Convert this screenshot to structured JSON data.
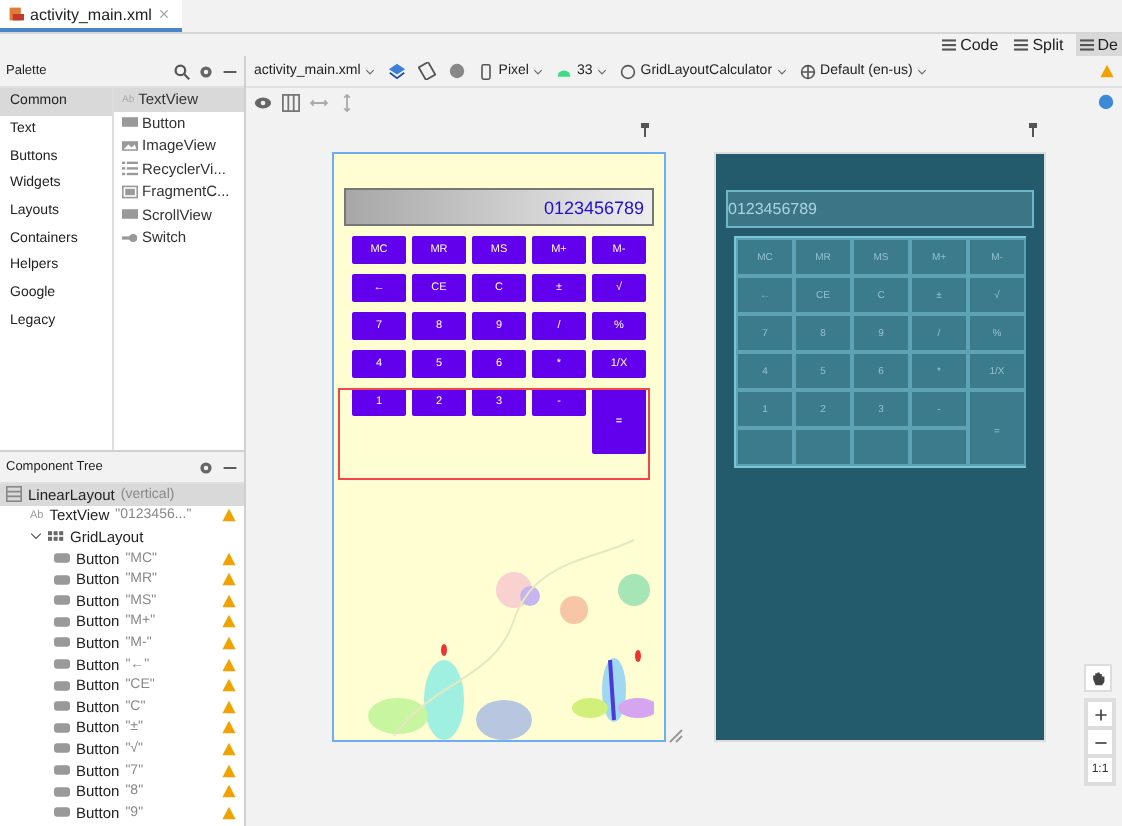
{
  "editor_tabs": [
    {
      "label": "activity_main.xml",
      "selected": true
    }
  ],
  "view_modes": [
    {
      "label": "Code",
      "selected": false
    },
    {
      "label": "Split",
      "selected": false
    },
    {
      "label": "De",
      "selected": true
    }
  ],
  "palette": {
    "title": "Palette",
    "categories": [
      {
        "label": "Common",
        "selected": true
      },
      {
        "label": "Text",
        "selected": false
      },
      {
        "label": "Buttons",
        "selected": false
      },
      {
        "label": "Widgets",
        "selected": false
      },
      {
        "label": "Layouts",
        "selected": false
      },
      {
        "label": "Containers",
        "selected": false
      },
      {
        "label": "Helpers",
        "selected": false
      },
      {
        "label": "Google",
        "selected": false
      },
      {
        "label": "Legacy",
        "selected": false
      }
    ],
    "items": [
      {
        "label": "TextView",
        "kind": "text",
        "badge": "Ab",
        "selected": true
      },
      {
        "label": "Button",
        "kind": "button",
        "selected": false
      },
      {
        "label": "ImageView",
        "kind": "image",
        "selected": false
      },
      {
        "label": "RecyclerVi...",
        "kind": "list",
        "selected": false
      },
      {
        "label": "FragmentC...",
        "kind": "fragment",
        "selected": false
      },
      {
        "label": "ScrollView",
        "kind": "button",
        "selected": false
      },
      {
        "label": "Switch",
        "kind": "switch",
        "selected": false
      }
    ]
  },
  "toolbar": {
    "file": "activity_main.xml",
    "device": "Pixel",
    "api": "33",
    "theme": "GridLayoutCalculator",
    "locale": "Default (en-us)"
  },
  "component_tree": {
    "title": "Component Tree",
    "nodes": [
      {
        "kind": "linear",
        "type": "LinearLayout",
        "detail": "(vertical)",
        "selected": true,
        "warning": false,
        "children": [
          {
            "kind": "text",
            "badge": "Ab",
            "type": "TextView",
            "detail": "\"0123456...\"",
            "selected": false,
            "warning": true
          },
          {
            "kind": "grid",
            "type": "GridLayout",
            "selected": false,
            "warning": false,
            "expanded": true,
            "children": [
              {
                "kind": "button",
                "type": "Button",
                "detail": "\"MC\"",
                "selected": false,
                "warning": true
              },
              {
                "kind": "button",
                "type": "Button",
                "detail": "\"MR\"",
                "selected": false,
                "warning": true
              },
              {
                "kind": "button",
                "type": "Button",
                "detail": "\"MS\"",
                "selected": false,
                "warning": true
              },
              {
                "kind": "button",
                "type": "Button",
                "detail": "\"M+\"",
                "selected": false,
                "warning": true
              },
              {
                "kind": "button",
                "type": "Button",
                "detail": "\"M-\"",
                "selected": false,
                "warning": true
              },
              {
                "kind": "button",
                "type": "Button",
                "detail": "\"←\"",
                "selected": false,
                "warning": true
              },
              {
                "kind": "button",
                "type": "Button",
                "detail": "\"CE\"",
                "selected": false,
                "warning": true
              },
              {
                "kind": "button",
                "type": "Button",
                "detail": "\"C\"",
                "selected": false,
                "warning": true
              },
              {
                "kind": "button",
                "type": "Button",
                "detail": "\"±\"",
                "selected": false,
                "warning": true
              },
              {
                "kind": "button",
                "type": "Button",
                "detail": "\"√\"",
                "selected": false,
                "warning": true
              },
              {
                "kind": "button",
                "type": "Button",
                "detail": "\"7\"",
                "selected": false,
                "warning": true
              },
              {
                "kind": "button",
                "type": "Button",
                "detail": "\"8\"",
                "selected": false,
                "warning": true
              },
              {
                "kind": "button",
                "type": "Button",
                "detail": "\"9\"",
                "selected": false,
                "warning": true
              }
            ]
          }
        ]
      }
    ]
  },
  "design": {
    "display": "0123456789",
    "keys": [
      {
        "label": "MC",
        "kind": "normal"
      },
      {
        "label": "MR",
        "kind": "normal"
      },
      {
        "label": "MS",
        "kind": "normal"
      },
      {
        "label": "M+",
        "kind": "normal"
      },
      {
        "label": "M-",
        "kind": "normal"
      },
      {
        "label": "←",
        "kind": "normal"
      },
      {
        "label": "CE",
        "kind": "normal"
      },
      {
        "label": "C",
        "kind": "normal"
      },
      {
        "label": "±",
        "kind": "normal"
      },
      {
        "label": "√",
        "kind": "normal"
      },
      {
        "label": "7",
        "kind": "normal"
      },
      {
        "label": "8",
        "kind": "normal"
      },
      {
        "label": "9",
        "kind": "normal"
      },
      {
        "label": "/",
        "kind": "normal"
      },
      {
        "label": "%",
        "kind": "normal"
      },
      {
        "label": "4",
        "kind": "normal"
      },
      {
        "label": "5",
        "kind": "normal"
      },
      {
        "label": "6",
        "kind": "normal"
      },
      {
        "label": "*",
        "kind": "normal"
      },
      {
        "label": "1/X",
        "kind": "normal"
      },
      {
        "label": "1",
        "kind": "normal"
      },
      {
        "label": "2",
        "kind": "normal"
      },
      {
        "label": "3",
        "kind": "normal"
      },
      {
        "label": "-",
        "kind": "normal"
      },
      {
        "label": "=",
        "kind": "tall"
      }
    ]
  },
  "blueprint": {
    "display": "0123456789",
    "keys": [
      {
        "label": "MC",
        "kind": "normal"
      },
      {
        "label": "MR",
        "kind": "normal"
      },
      {
        "label": "MS",
        "kind": "normal"
      },
      {
        "label": "M+",
        "kind": "normal"
      },
      {
        "label": "M-",
        "kind": "normal"
      },
      {
        "label": "←",
        "kind": "normal"
      },
      {
        "label": "CE",
        "kind": "normal"
      },
      {
        "label": "C",
        "kind": "normal"
      },
      {
        "label": "±",
        "kind": "normal"
      },
      {
        "label": "√",
        "kind": "normal"
      },
      {
        "label": "7",
        "kind": "normal"
      },
      {
        "label": "8",
        "kind": "normal"
      },
      {
        "label": "9",
        "kind": "normal"
      },
      {
        "label": "/",
        "kind": "normal"
      },
      {
        "label": "%",
        "kind": "normal"
      },
      {
        "label": "4",
        "kind": "normal"
      },
      {
        "label": "5",
        "kind": "normal"
      },
      {
        "label": "6",
        "kind": "normal"
      },
      {
        "label": "*",
        "kind": "normal"
      },
      {
        "label": "1/X",
        "kind": "normal"
      },
      {
        "label": "1",
        "kind": "normal"
      },
      {
        "label": "2",
        "kind": "normal"
      },
      {
        "label": "3",
        "kind": "normal"
      },
      {
        "label": "-",
        "kind": "normal"
      },
      {
        "label": "=",
        "kind": "tall"
      }
    ]
  },
  "zoom_controls": {
    "reset": "1:1"
  }
}
